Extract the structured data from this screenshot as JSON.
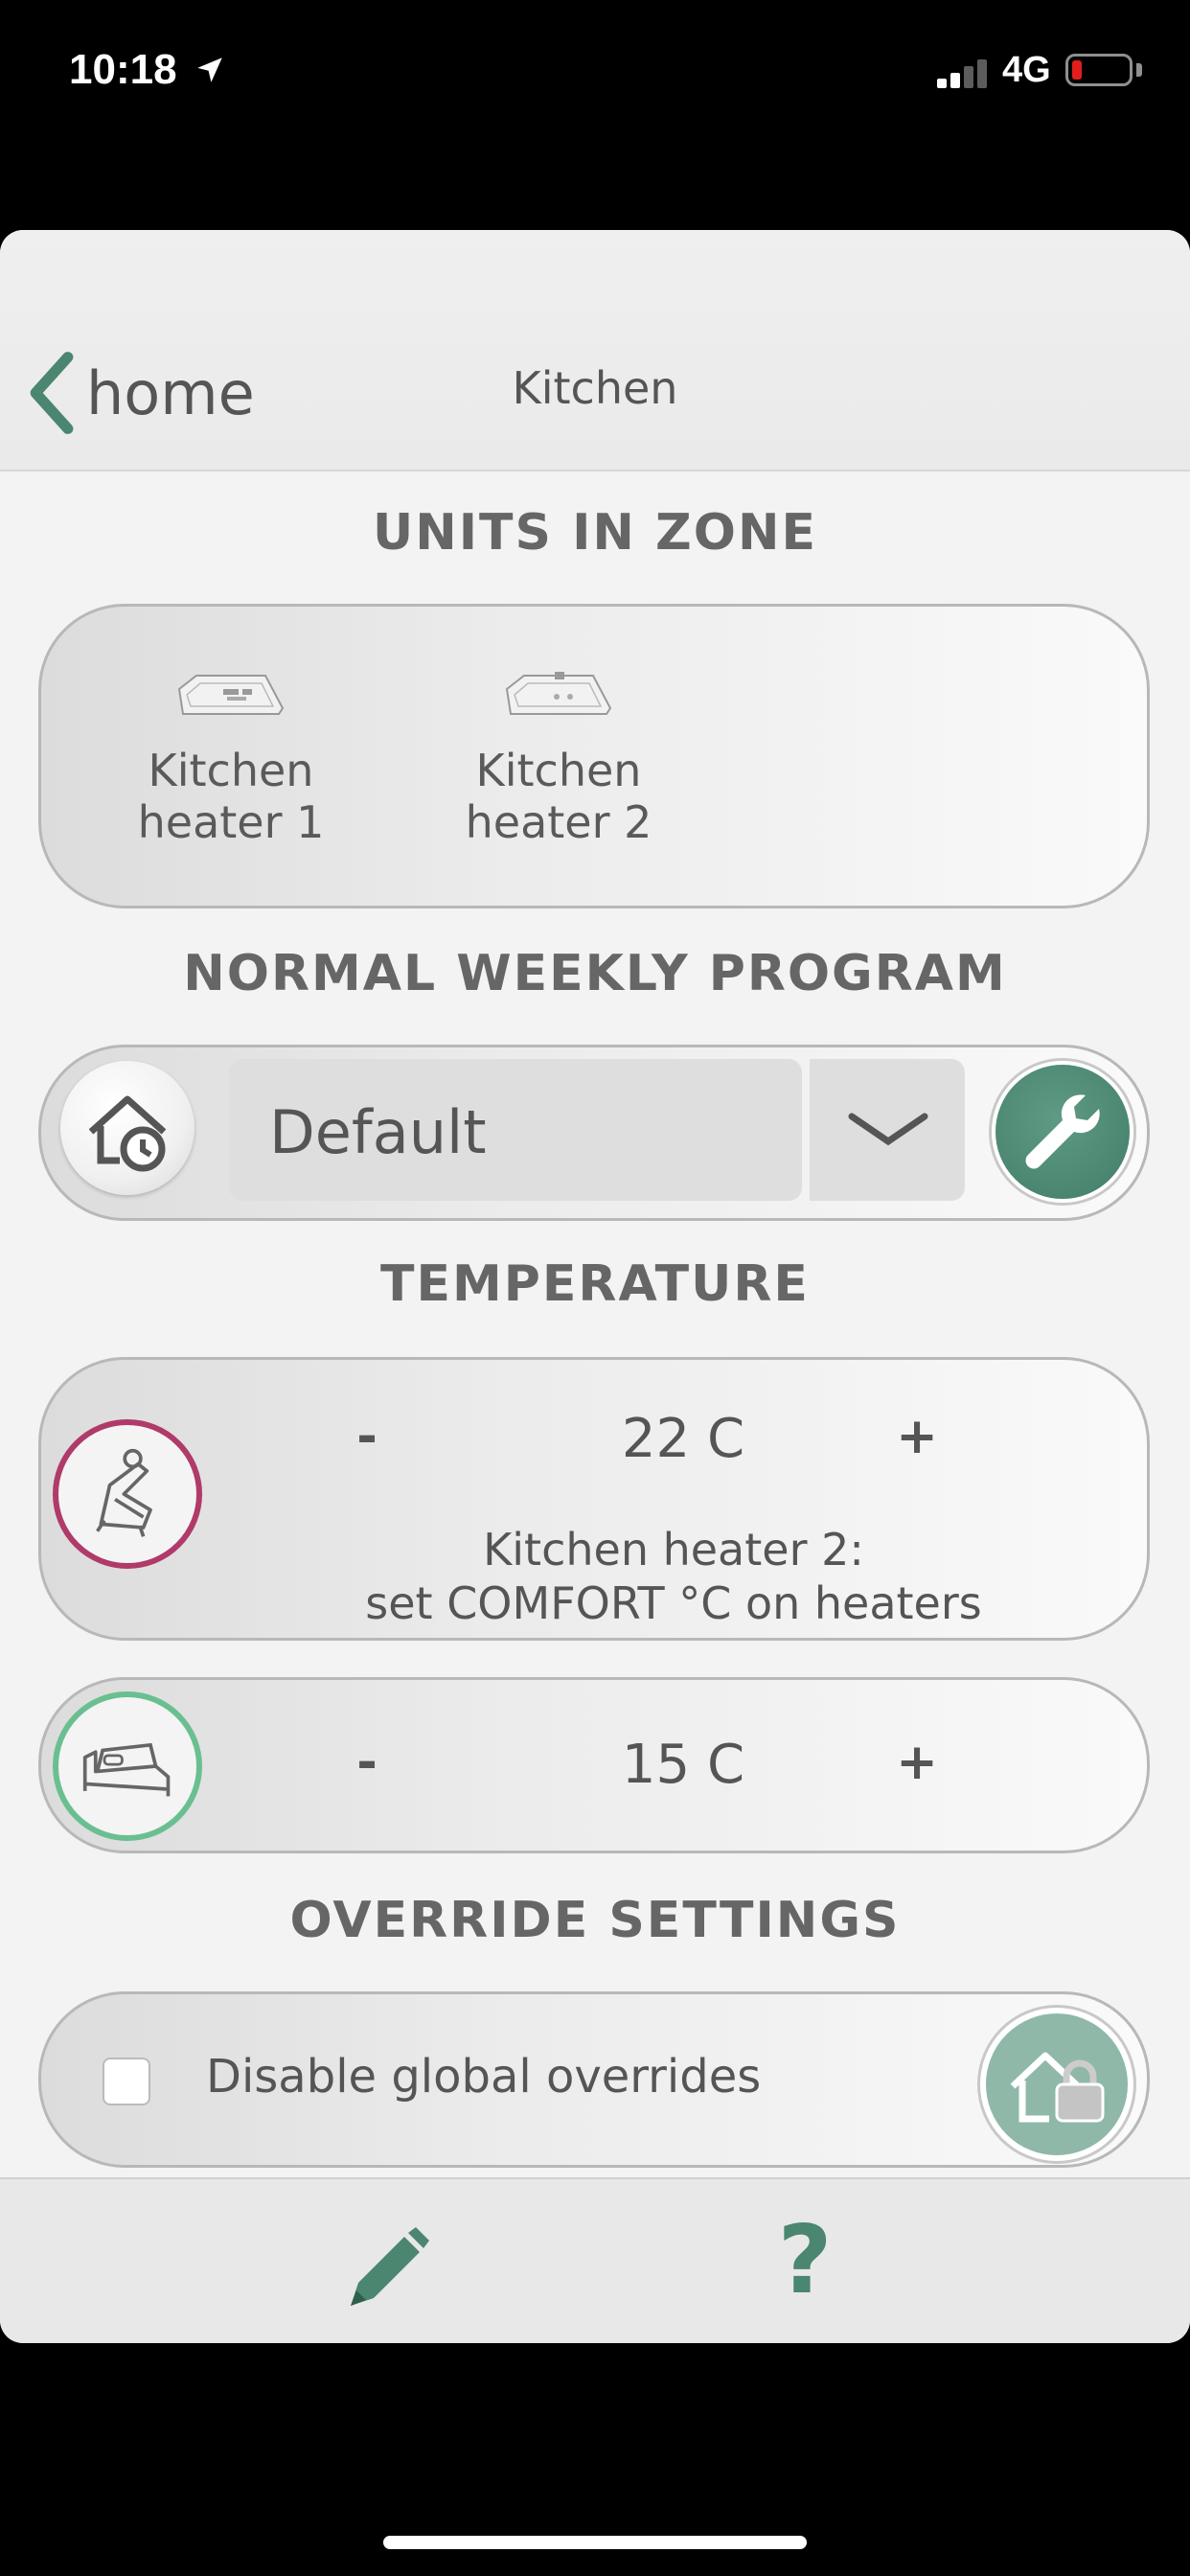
{
  "status_bar": {
    "time": "10:18",
    "network": "4G",
    "battery_level": 0.1,
    "battery_color": "#e01e1e",
    "signal_bars": 2
  },
  "nav": {
    "back_label": "home",
    "title": "Kitchen",
    "accent": "#4a8670"
  },
  "units_section": {
    "title": "UNITS IN ZONE",
    "units": [
      {
        "line1": "Kitchen",
        "line2": "heater 1",
        "icon": "heater-icon"
      },
      {
        "line1": "Kitchen",
        "line2": "heater 2",
        "icon": "heater-icon"
      }
    ]
  },
  "program_section": {
    "title": "NORMAL WEEKLY PROGRAM",
    "selected": "Default",
    "icon": "home-clock-icon",
    "settings_icon": "wrench-icon"
  },
  "temperature_section": {
    "title": "TEMPERATURE",
    "comfort": {
      "minus": "-",
      "value": "22 C",
      "plus": "+",
      "note_line1": "Kitchen heater 2:",
      "note_line2": "set COMFORT °C on heaters",
      "icon": "armchair-icon",
      "ring_color": "#b03a6a"
    },
    "eco": {
      "minus": "-",
      "value": "15 C",
      "plus": "+",
      "icon": "bed-icon",
      "ring_color": "#6abf90"
    }
  },
  "override_section": {
    "title": "OVERRIDE SETTINGS",
    "checkbox_label": "Disable global overrides",
    "checked": false,
    "icon": "home-lock-icon"
  },
  "bottom_bar": {
    "edit_icon": "pencil-icon",
    "help_label": "?"
  }
}
